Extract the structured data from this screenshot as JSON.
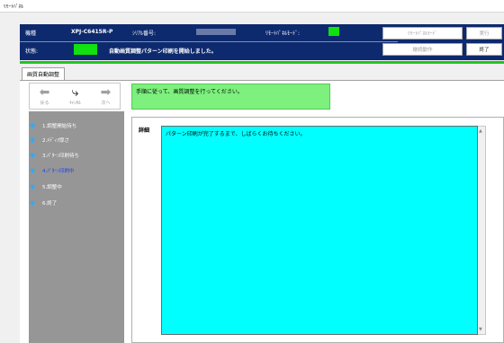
{
  "window": {
    "title": "ﾘﾓｰﾄﾊﾟﾈﾙ"
  },
  "header": {
    "model_label": "機種",
    "model_value": "XPJ-C6415R-P",
    "serial_label": "ｼﾘｱﾙ番号:",
    "remote_mode_label": "ﾘﾓｰﾄﾊﾟﾈﾙﾓｰﾄﾞ:",
    "status_label": "状態:",
    "status_message": "自動画質調整パターン印刷を開始しました。",
    "buttons": {
      "remote_mode": "ﾘﾓｰﾄﾊﾟﾈﾙﾓｰﾄﾞ",
      "execute": "実行",
      "continue_operation": "継続動作",
      "finish": "終了"
    },
    "colors": {
      "bar": "#0e2a6e",
      "indicator": "#11e011"
    }
  },
  "tab": {
    "label": "画質自動調整"
  },
  "nav": {
    "back": "戻る",
    "cancel": "ｷｬﾝｾﾙ",
    "next": "次へ"
  },
  "instruction": "手順に従って、画質調整を行ってください。",
  "steps": [
    {
      "label": "1.調整開始待ち",
      "state": "done"
    },
    {
      "label": "2.ﾒﾃﾞｨｱ厚さ",
      "state": "done"
    },
    {
      "label": "3.ﾊﾟﾀｰﾝ印刷待ち",
      "state": "done"
    },
    {
      "label": "4.ﾊﾟﾀｰﾝ印刷中",
      "state": "current"
    },
    {
      "label": "5.調整中",
      "state": "pending"
    },
    {
      "label": "6.終了",
      "state": "pending"
    }
  ],
  "detail": {
    "label": "詳細",
    "message": "パターン印刷が完了するまで、しばらくお待ちください。",
    "color": "#00ffff"
  },
  "icons": {
    "back": "left-arrow-icon",
    "cancel": "curved-arrow-icon",
    "next": "right-arrow-icon",
    "step": "triangle-down-icon"
  }
}
